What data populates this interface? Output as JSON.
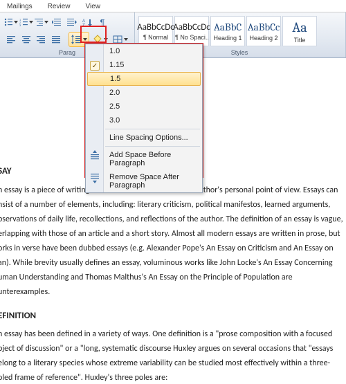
{
  "tabs": {
    "mailings": "Mailings",
    "review": "Review",
    "view": "View"
  },
  "groups": {
    "paragraph": "Parag",
    "styles": "Styles"
  },
  "styles": [
    {
      "sample": "AaBbCcDc",
      "name": "¶ Normal"
    },
    {
      "sample": "AaBbCcDc",
      "name": "¶ No Spaci..."
    },
    {
      "sample": "AaBbC",
      "name": "Heading 1"
    },
    {
      "sample": "AaBbCc",
      "name": "Heading 2"
    },
    {
      "sample": "Aa",
      "name": "Title"
    }
  ],
  "spacingMenu": {
    "values": [
      "1.0",
      "1.15",
      "1.5",
      "2.0",
      "2.5",
      "3.0"
    ],
    "checked": "1.15",
    "hover": "1.5",
    "options": "Line Spacing Options...",
    "addBefore": "Add Space Before Paragraph",
    "removeAfter": "Remove Space After Paragraph"
  },
  "document": {
    "h1": "SAY",
    "p1": "n essay is a piece of writing which is often written from an author's personal point of view. Essays can",
    "p2": "nsist of a number of elements, including: literary criticism, political manifestos, learned arguments,",
    "p3": "bservations of daily life, recollections, and reflections of the author. The definition of an essay is vague,",
    "p4": "erlapping with those of an article  and a short story. Almost all modern essays are written in prose, but",
    "p5": "orks in verse have been dubbed essays (e.g. Alexander Pope's An Essay on Criticism and An Essay on",
    "p6": "an). While brevity usually defines an essay, voluminous works like John Locke's An Essay Concerning",
    "p7": "uman Understanding and Thomas Malthus's An Essay on the Principle of Population are",
    "p8": "unterexamples.",
    "h2": "EFINITION",
    "p9": "n essay has been defined in a variety of ways. One definition is a \"prose composition with a focused",
    "p10": "bject of discussion\" or a \"long, systematic discourse Huxley argues on several occasions that \"essays",
    "p11": "elong to a literary species whose extreme variability can be studied most effectively within a three-",
    "p12": "oled frame of reference\". Huxley's three poles are:"
  }
}
